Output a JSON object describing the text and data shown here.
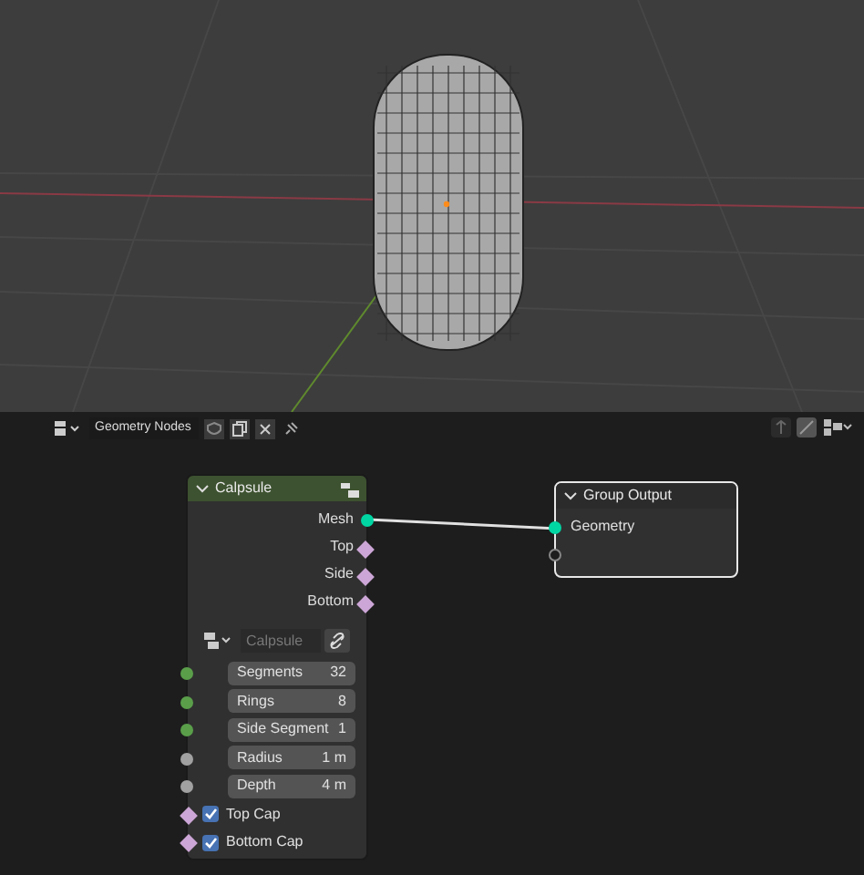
{
  "viewport": {
    "kind": "perspective"
  },
  "header": {
    "editor_label": "Geometry Nodes"
  },
  "nodes": [
    {
      "title": "Calpsule",
      "expanded": true,
      "selected": false,
      "outputs": [
        {
          "label": "Mesh",
          "color": "#00d6a3"
        },
        {
          "label": "Top",
          "color": "#cca6d6"
        },
        {
          "label": "Side",
          "color": "#cca6d6"
        },
        {
          "label": "Bottom",
          "color": "#cca6d6"
        }
      ],
      "datablock": {
        "placeholder": "Calpsule"
      },
      "inputs": [
        {
          "kind": "field",
          "label": "Segments",
          "value": "32",
          "color": "#5a9e4a"
        },
        {
          "kind": "field",
          "label": "Rings",
          "value": "8",
          "color": "#5a9e4a"
        },
        {
          "kind": "field",
          "label": "Side Segment",
          "value": "1",
          "color": "#5a9e4a"
        },
        {
          "kind": "field",
          "label": "Radius",
          "value": "1 m",
          "color": "#a1a1a1"
        },
        {
          "kind": "field",
          "label": "Depth",
          "value": "4 m",
          "color": "#a1a1a1"
        },
        {
          "kind": "checkbox",
          "label": "Top Cap",
          "checked": true,
          "color": "#cca6d6"
        },
        {
          "kind": "checkbox",
          "label": "Bottom Cap",
          "checked": true,
          "color": "#cca6d6"
        }
      ]
    },
    {
      "title": "Group Output",
      "expanded": true,
      "selected": true,
      "inputs": [
        {
          "kind": "socket",
          "label": "Geometry",
          "color": "#00d6a3"
        },
        {
          "kind": "empty",
          "color": "#1d1d1d"
        }
      ]
    }
  ]
}
